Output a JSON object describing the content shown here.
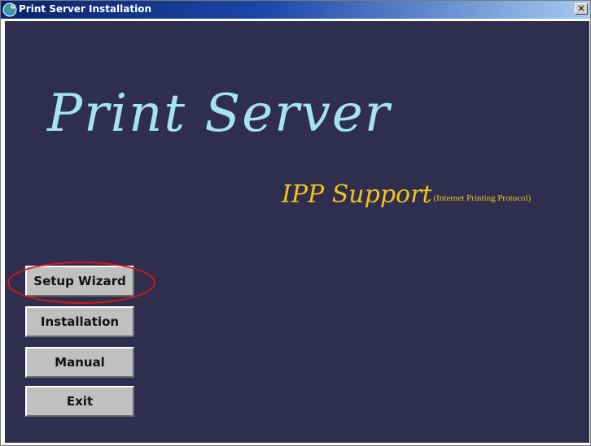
{
  "window": {
    "title": "Print Server Installation",
    "icon": "globe-cd-icon",
    "close_glyph": "✕"
  },
  "content": {
    "background_color": "#302e4f",
    "logo_text": "Print Server",
    "logo_color": "#a6e3f0",
    "tagline": "IPP Support",
    "tagline_sub": "(Internet Printing Protocol)",
    "tagline_color": "#f0c419"
  },
  "menu": {
    "setup_wizard": "Setup Wizard",
    "installation": "Installation",
    "manual": "Manual",
    "exit": "Exit"
  },
  "annotation": {
    "highlight_color": "#d81616",
    "highlighted_item": "Setup Wizard"
  }
}
